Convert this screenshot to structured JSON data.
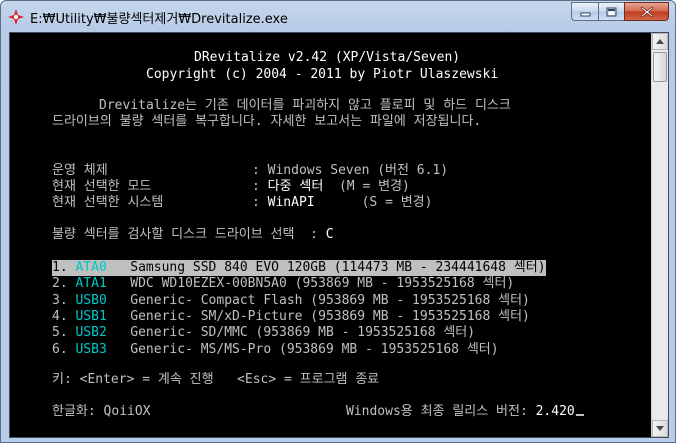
{
  "window": {
    "title": "E:₩Utility₩불량섹터제거₩Drevitalize.exe"
  },
  "header": {
    "line1": "DRevitalize v2.42 (XP/Vista/Seven)",
    "line2": "Copyright (c) 2004 - 2011 by Piotr Ulaszewski"
  },
  "intro": {
    "line1": "Drevitalize는 기존 데이터를 파괴하지 않고 플로피 및 하드 디스크",
    "line2": "드라이브의 불량 섹터를 복구합니다. 자세한 보고서는 파일에 저장됩니다."
  },
  "settings": [
    {
      "label": "운영 체제",
      "sep": ":",
      "value": "Windows Seven",
      "extra": "(버전 6.1)"
    },
    {
      "label": "현재 선택한 모드",
      "sep": ":",
      "value": "다중 섹터",
      "extra": "(M = 변경)"
    },
    {
      "label": "현재 선택한 시스템",
      "sep": ":",
      "value": "WinAPI",
      "extra": "(S = 변경)"
    }
  ],
  "prompt": {
    "question": "불량 섹터를 검사할 디스크 드라이브 선택",
    "sep": ":",
    "answer": "C"
  },
  "drives": [
    {
      "num": "1.",
      "id": "ATA0",
      "desc": "Samsung SSD 840 EVO 120GB (114473 MB - 234441648 섹터)",
      "selected": true
    },
    {
      "num": "2.",
      "id": "ATA1",
      "desc": "WDC WD10EZEX-00BN5A0 (953869 MB - 1953525168 섹터)",
      "selected": false
    },
    {
      "num": "3.",
      "id": "USB0",
      "desc": "Generic- Compact Flash (953869 MB - 1953525168 섹터)",
      "selected": false
    },
    {
      "num": "4.",
      "id": "USB1",
      "desc": "Generic- SM/xD-Picture (953869 MB - 1953525168 섹터)",
      "selected": false
    },
    {
      "num": "5.",
      "id": "USB2",
      "desc": "Generic- SD/MMC (953869 MB - 1953525168 섹터)",
      "selected": false
    },
    {
      "num": "6.",
      "id": "USB3",
      "desc": "Generic- MS/MS-Pro (953869 MB - 1953525168 섹터)",
      "selected": false
    }
  ],
  "keys": {
    "prefix": "키:",
    "enter": "<Enter> = 계속 진행",
    "esc": "<Esc> = 프로그램 종료"
  },
  "footer": {
    "credit_label": "한글화:",
    "credit_value": "QoiiOX",
    "release_label": "Windows용 최종 릴리스 버전:",
    "release_value": "2.420"
  },
  "colors": {
    "console_bg": "#000000",
    "text": "#c0c0c0",
    "bright": "#ffffff",
    "drive_id": "#00c8c8",
    "selection_bg": "#c0c0c0"
  }
}
